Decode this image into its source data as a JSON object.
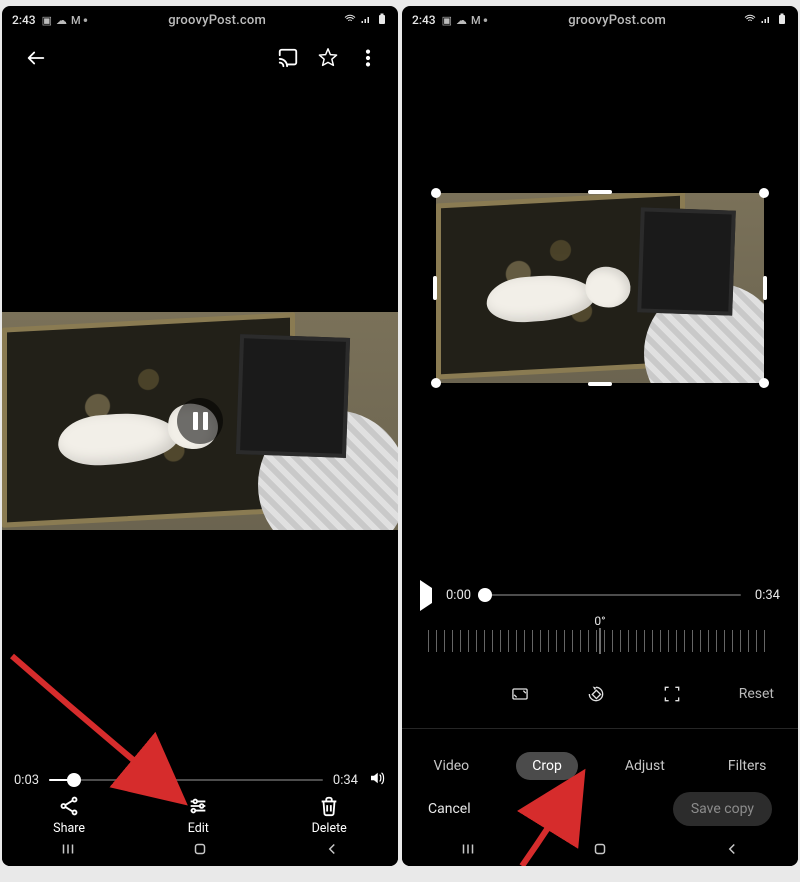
{
  "status": {
    "time": "2:43",
    "brand": "groovyPost.com"
  },
  "left": {
    "playback": {
      "current": "0:03",
      "total": "0:34",
      "progress_pct": 9
    },
    "actions": {
      "share": "Share",
      "edit": "Edit",
      "delete": "Delete"
    }
  },
  "right": {
    "playback": {
      "current": "0:00",
      "total": "0:34",
      "progress_pct": 0
    },
    "rotation": "0°",
    "reset": "Reset",
    "tabs": {
      "video": "Video",
      "crop": "Crop",
      "adjust": "Adjust",
      "filters": "Filters"
    },
    "cancel": "Cancel",
    "save_copy": "Save copy"
  }
}
